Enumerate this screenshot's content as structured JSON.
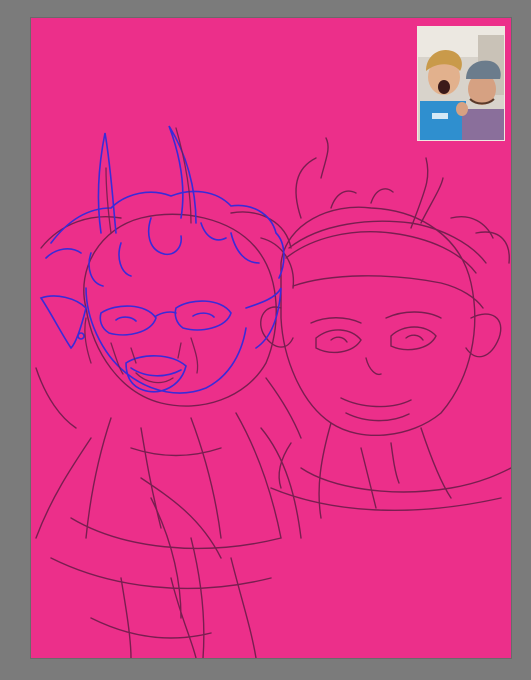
{
  "app": {
    "canvas_background_color": "#ec2f8a",
    "workspace_background_color": "#7b7b7b",
    "sketch_line_color": "#6d1d4a",
    "ink_line_color": "#3a2bd8"
  },
  "artwork": {
    "subject": "two-character-sketch-with-horns",
    "figures": [
      "left-figure-inked",
      "right-figure-sketch"
    ]
  },
  "video_call": {
    "pip_icon": "video-preview-thumbnail"
  }
}
